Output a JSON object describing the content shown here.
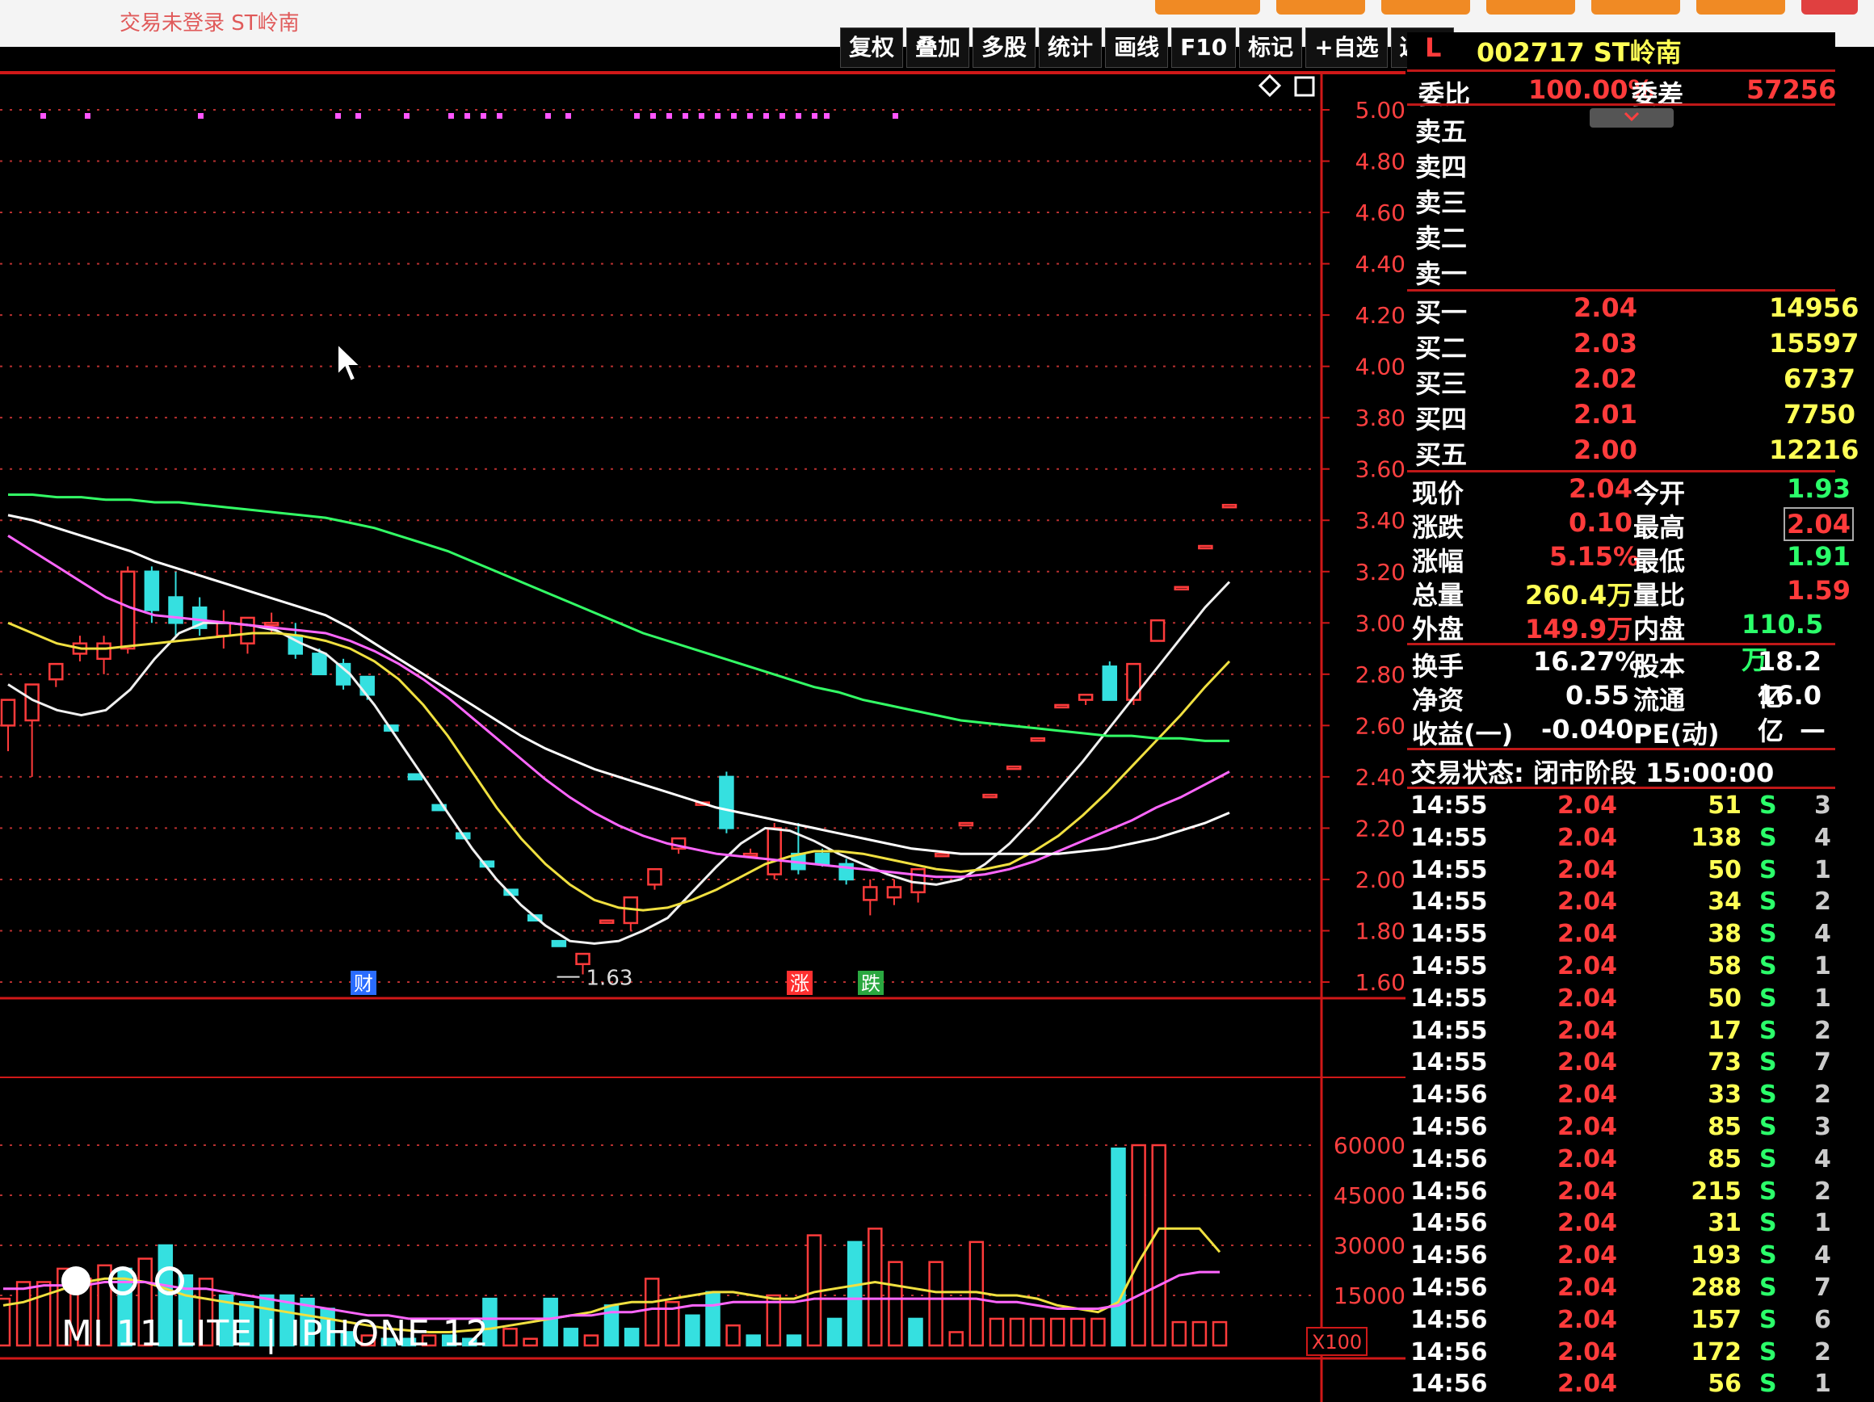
{
  "window": {
    "login_status": "交易未登录",
    "title_stock": "ST岭南"
  },
  "toolbar": {
    "buttons": [
      "复权",
      "叠加",
      "多股",
      "统计",
      "画线",
      "F10",
      "标记",
      "+自选",
      "返回"
    ]
  },
  "stock": {
    "level": "L",
    "code_name": "002717 ST岭南",
    "weibi_label": "委比",
    "weibi_value": "100.00%",
    "weicha_label": "委差",
    "weicha_value": "57256"
  },
  "order_book": {
    "sell": [
      {
        "label": "卖五",
        "price": "",
        "volume": ""
      },
      {
        "label": "卖四",
        "price": "",
        "volume": ""
      },
      {
        "label": "卖三",
        "price": "",
        "volume": ""
      },
      {
        "label": "卖二",
        "price": "",
        "volume": ""
      },
      {
        "label": "卖一",
        "price": "",
        "volume": ""
      }
    ],
    "buy": [
      {
        "label": "买一",
        "price": "2.04",
        "volume": "14956"
      },
      {
        "label": "买二",
        "price": "2.03",
        "volume": "15597"
      },
      {
        "label": "买三",
        "price": "2.02",
        "volume": "6737"
      },
      {
        "label": "买四",
        "price": "2.01",
        "volume": "7750"
      },
      {
        "label": "买五",
        "price": "2.00",
        "volume": "12216"
      }
    ]
  },
  "quote": [
    {
      "l1": "现价",
      "v1": "2.04",
      "l2": "今开",
      "v2": "1.93"
    },
    {
      "l1": "涨跌",
      "v1": "0.10",
      "l2": "最高",
      "v2": "2.04"
    },
    {
      "l1": "涨幅",
      "v1": "5.15%",
      "l2": "最低",
      "v2": "1.91"
    },
    {
      "l1": "总量",
      "v1": "260.4万",
      "l2": "量比",
      "v2": "1.59"
    },
    {
      "l1": "外盘",
      "v1": "149.9万",
      "l2": "内盘",
      "v2": "110.5万"
    }
  ],
  "fundamentals": [
    {
      "l1": "换手",
      "v1": "16.27%",
      "l2": "股本",
      "v2": "18.2亿"
    },
    {
      "l1": "净资",
      "v1": "0.55",
      "l2": "流通",
      "v2": "16.0亿"
    },
    {
      "l1": "收益(一)",
      "v1": "-0.040",
      "l2": "PE(动)",
      "v2": "—"
    }
  ],
  "trade_status": "交易状态: 闭市阶段 15:00:00",
  "ticks": [
    {
      "time": "14:55",
      "price": "2.04",
      "vol": "51",
      "side": "S",
      "n": "3"
    },
    {
      "time": "14:55",
      "price": "2.04",
      "vol": "138",
      "side": "S",
      "n": "4"
    },
    {
      "time": "14:55",
      "price": "2.04",
      "vol": "50",
      "side": "S",
      "n": "1"
    },
    {
      "time": "14:55",
      "price": "2.04",
      "vol": "34",
      "side": "S",
      "n": "2"
    },
    {
      "time": "14:55",
      "price": "2.04",
      "vol": "38",
      "side": "S",
      "n": "4"
    },
    {
      "time": "14:55",
      "price": "2.04",
      "vol": "58",
      "side": "S",
      "n": "1"
    },
    {
      "time": "14:55",
      "price": "2.04",
      "vol": "50",
      "side": "S",
      "n": "1"
    },
    {
      "time": "14:55",
      "price": "2.04",
      "vol": "17",
      "side": "S",
      "n": "2"
    },
    {
      "time": "14:55",
      "price": "2.04",
      "vol": "73",
      "side": "S",
      "n": "7"
    },
    {
      "time": "14:56",
      "price": "2.04",
      "vol": "33",
      "side": "S",
      "n": "2"
    },
    {
      "time": "14:56",
      "price": "2.04",
      "vol": "85",
      "side": "S",
      "n": "3"
    },
    {
      "time": "14:56",
      "price": "2.04",
      "vol": "85",
      "side": "S",
      "n": "4"
    },
    {
      "time": "14:56",
      "price": "2.04",
      "vol": "215",
      "side": "S",
      "n": "2"
    },
    {
      "time": "14:56",
      "price": "2.04",
      "vol": "31",
      "side": "S",
      "n": "1"
    },
    {
      "time": "14:56",
      "price": "2.04",
      "vol": "193",
      "side": "S",
      "n": "4"
    },
    {
      "time": "14:56",
      "price": "2.04",
      "vol": "288",
      "side": "S",
      "n": "7"
    },
    {
      "time": "14:56",
      "price": "2.04",
      "vol": "157",
      "side": "S",
      "n": "6"
    },
    {
      "time": "14:56",
      "price": "2.04",
      "vol": "172",
      "side": "S",
      "n": "2"
    },
    {
      "time": "14:56",
      "price": "2.04",
      "vol": "56",
      "side": "S",
      "n": "1"
    }
  ],
  "chart": {
    "price_ticks": [
      "5.00",
      "4.80",
      "4.60",
      "4.40",
      "4.20",
      "4.00",
      "3.80",
      "3.60",
      "3.40",
      "3.20",
      "3.00",
      "2.80",
      "2.60",
      "2.40",
      "2.20",
      "2.00",
      "1.80",
      "1.60"
    ],
    "volume_ticks": [
      "60000",
      "45000",
      "30000",
      "15000"
    ],
    "volume_unit": "X100",
    "low_marker": "1.63",
    "event_labels": [
      "财",
      "涨",
      "跌"
    ]
  },
  "chart_data": {
    "type": "candlestick",
    "ylim": [
      1.6,
      5.0
    ],
    "candles": [
      {
        "o": 2.6,
        "h": 2.7,
        "l": 2.5,
        "c": 2.7
      },
      {
        "o": 2.62,
        "h": 2.75,
        "l": 2.4,
        "c": 2.76
      },
      {
        "o": 2.78,
        "h": 2.82,
        "l": 2.75,
        "c": 2.84
      },
      {
        "o": 2.88,
        "h": 2.95,
        "l": 2.85,
        "c": 2.92
      },
      {
        "o": 2.86,
        "h": 2.95,
        "l": 2.8,
        "c": 2.92
      },
      {
        "o": 2.9,
        "h": 3.22,
        "l": 2.88,
        "c": 3.2
      },
      {
        "o": 3.2,
        "h": 3.22,
        "l": 3.0,
        "c": 3.05
      },
      {
        "o": 3.1,
        "h": 3.2,
        "l": 2.95,
        "c": 3.0
      },
      {
        "o": 3.06,
        "h": 3.1,
        "l": 2.95,
        "c": 2.98
      },
      {
        "o": 2.95,
        "h": 3.05,
        "l": 2.9,
        "c": 3.0
      },
      {
        "o": 2.92,
        "h": 3.02,
        "l": 2.88,
        "c": 3.02
      },
      {
        "o": 3.0,
        "h": 3.04,
        "l": 2.96,
        "c": 3.0
      },
      {
        "o": 2.95,
        "h": 3.0,
        "l": 2.86,
        "c": 2.88
      },
      {
        "o": 2.88,
        "h": 2.9,
        "l": 2.8,
        "c": 2.8
      },
      {
        "o": 2.84,
        "h": 2.86,
        "l": 2.74,
        "c": 2.76
      },
      {
        "o": 2.79,
        "h": 2.79,
        "l": 2.7,
        "c": 2.72
      },
      {
        "o": 2.6,
        "h": 2.6,
        "l": 2.58,
        "c": 2.58
      },
      {
        "o": 2.41,
        "h": 2.41,
        "l": 2.39,
        "c": 2.39
      },
      {
        "o": 2.29,
        "h": 2.29,
        "l": 2.27,
        "c": 2.27
      },
      {
        "o": 2.18,
        "h": 2.18,
        "l": 2.16,
        "c": 2.16
      },
      {
        "o": 2.07,
        "h": 2.07,
        "l": 2.05,
        "c": 2.05
      },
      {
        "o": 1.96,
        "h": 1.96,
        "l": 1.94,
        "c": 1.94
      },
      {
        "o": 1.86,
        "h": 1.86,
        "l": 1.84,
        "c": 1.84
      },
      {
        "o": 1.76,
        "h": 1.76,
        "l": 1.74,
        "c": 1.74
      },
      {
        "o": 1.67,
        "h": 1.7,
        "l": 1.63,
        "c": 1.71
      },
      {
        "o": 1.84,
        "h": 1.84,
        "l": 1.84,
        "c": 1.84
      },
      {
        "o": 1.83,
        "h": 1.93,
        "l": 1.8,
        "c": 1.93
      },
      {
        "o": 1.98,
        "h": 2.04,
        "l": 1.96,
        "c": 2.04
      },
      {
        "o": 2.12,
        "h": 2.16,
        "l": 2.1,
        "c": 2.16
      },
      {
        "o": 2.3,
        "h": 2.3,
        "l": 2.3,
        "c": 2.3
      },
      {
        "o": 2.4,
        "h": 2.42,
        "l": 2.18,
        "c": 2.2
      },
      {
        "o": 2.1,
        "h": 2.12,
        "l": 2.09,
        "c": 2.1
      },
      {
        "o": 2.02,
        "h": 2.22,
        "l": 2.0,
        "c": 2.2
      },
      {
        "o": 2.1,
        "h": 2.22,
        "l": 2.02,
        "c": 2.04
      },
      {
        "o": 2.1,
        "h": 2.12,
        "l": 2.05,
        "c": 2.06
      },
      {
        "o": 2.06,
        "h": 2.08,
        "l": 1.98,
        "c": 2.0
      },
      {
        "o": 1.92,
        "h": 2.0,
        "l": 1.86,
        "c": 1.97
      },
      {
        "o": 1.93,
        "h": 2.0,
        "l": 1.9,
        "c": 1.97
      },
      {
        "o": 1.95,
        "h": 2.04,
        "l": 1.91,
        "c": 2.04
      },
      {
        "o": 2.1,
        "h": 2.1,
        "l": 2.1,
        "c": 2.1
      },
      {
        "o": 2.22,
        "h": 2.22,
        "l": 2.22,
        "c": 2.22
      },
      {
        "o": 2.33,
        "h": 2.33,
        "l": 2.33,
        "c": 2.33
      },
      {
        "o": 2.44,
        "h": 2.44,
        "l": 2.44,
        "c": 2.44
      },
      {
        "o": 2.55,
        "h": 2.55,
        "l": 2.55,
        "c": 2.55
      },
      {
        "o": 2.68,
        "h": 2.68,
        "l": 2.68,
        "c": 2.68
      },
      {
        "o": 2.7,
        "h": 2.72,
        "l": 2.68,
        "c": 2.72
      },
      {
        "o": 2.83,
        "h": 2.85,
        "l": 2.7,
        "c": 2.7
      },
      {
        "o": 2.7,
        "h": 2.84,
        "l": 2.68,
        "c": 2.84
      },
      {
        "o": 2.93,
        "h": 3.01,
        "l": 2.93,
        "c": 3.01
      },
      {
        "o": 3.14,
        "h": 3.14,
        "l": 3.14,
        "c": 3.14
      },
      {
        "o": 3.3,
        "h": 3.3,
        "l": 3.3,
        "c": 3.3
      },
      {
        "o": 3.46,
        "h": 3.46,
        "l": 3.46,
        "c": 3.46
      }
    ],
    "ma_series": [
      {
        "color": "#f0f0f0",
        "values": [
          2.76,
          2.7,
          2.66,
          2.64,
          2.66,
          2.74,
          2.86,
          2.96,
          3.0,
          3.0,
          2.99,
          2.97,
          2.92,
          2.88,
          2.8,
          2.68,
          2.54,
          2.4,
          2.26,
          2.12,
          2.0,
          1.9,
          1.82,
          1.76,
          1.75,
          1.76,
          1.8,
          1.85,
          1.95,
          2.05,
          2.14,
          2.2,
          2.19,
          2.15,
          2.1,
          2.06,
          2.02,
          1.99,
          1.98,
          2.0,
          2.06,
          2.14,
          2.24,
          2.35,
          2.46,
          2.58,
          2.7,
          2.82,
          2.94,
          3.06,
          3.16
        ]
      },
      {
        "color": "#f0e040",
        "values": [
          3.0,
          2.96,
          2.92,
          2.9,
          2.9,
          2.91,
          2.92,
          2.93,
          2.94,
          2.95,
          2.96,
          2.96,
          2.95,
          2.93,
          2.9,
          2.85,
          2.78,
          2.68,
          2.56,
          2.42,
          2.28,
          2.16,
          2.06,
          1.98,
          1.92,
          1.89,
          1.88,
          1.89,
          1.92,
          1.96,
          2.01,
          2.06,
          2.09,
          2.11,
          2.11,
          2.1,
          2.08,
          2.06,
          2.04,
          2.03,
          2.04,
          2.06,
          2.11,
          2.17,
          2.25,
          2.34,
          2.44,
          2.54,
          2.64,
          2.75,
          2.85
        ]
      },
      {
        "color": "#ff66ff",
        "values": [
          3.34,
          3.28,
          3.22,
          3.16,
          3.1,
          3.06,
          3.03,
          3.02,
          3.01,
          3.0,
          2.99,
          2.98,
          2.97,
          2.96,
          2.93,
          2.89,
          2.84,
          2.78,
          2.71,
          2.63,
          2.55,
          2.47,
          2.39,
          2.32,
          2.26,
          2.21,
          2.17,
          2.14,
          2.12,
          2.1,
          2.09,
          2.08,
          2.07,
          2.06,
          2.05,
          2.04,
          2.03,
          2.02,
          2.01,
          2.01,
          2.02,
          2.04,
          2.07,
          2.11,
          2.15,
          2.19,
          2.23,
          2.28,
          2.32,
          2.37,
          2.42
        ]
      },
      {
        "color": "#ffffff",
        "values": [
          3.42,
          3.4,
          3.37,
          3.34,
          3.31,
          3.28,
          3.24,
          3.21,
          3.18,
          3.15,
          3.12,
          3.09,
          3.06,
          3.03,
          2.98,
          2.92,
          2.86,
          2.8,
          2.74,
          2.68,
          2.62,
          2.56,
          2.51,
          2.47,
          2.43,
          2.4,
          2.37,
          2.34,
          2.31,
          2.28,
          2.26,
          2.24,
          2.22,
          2.2,
          2.18,
          2.16,
          2.14,
          2.12,
          2.11,
          2.1,
          2.1,
          2.1,
          2.1,
          2.1,
          2.11,
          2.12,
          2.14,
          2.16,
          2.19,
          2.22,
          2.26
        ]
      },
      {
        "color": "#33ff66",
        "values": [
          3.5,
          3.5,
          3.49,
          3.49,
          3.48,
          3.48,
          3.47,
          3.47,
          3.46,
          3.45,
          3.44,
          3.43,
          3.42,
          3.41,
          3.39,
          3.37,
          3.34,
          3.31,
          3.28,
          3.24,
          3.2,
          3.16,
          3.12,
          3.08,
          3.04,
          3.0,
          2.96,
          2.93,
          2.9,
          2.87,
          2.84,
          2.81,
          2.78,
          2.75,
          2.73,
          2.7,
          2.68,
          2.66,
          2.64,
          2.62,
          2.61,
          2.6,
          2.59,
          2.58,
          2.57,
          2.56,
          2.56,
          2.55,
          2.55,
          2.54,
          2.54
        ]
      }
    ],
    "volume_ylim": [
      0,
      75000
    ],
    "volumes": [
      14000,
      19000,
      19000,
      23000,
      20000,
      24000,
      23000,
      26000,
      30000,
      21000,
      20000,
      15000,
      13000,
      15000,
      15000,
      14000,
      11000,
      4000,
      3000,
      2000,
      2000,
      3000,
      3000,
      2000,
      14000,
      5000,
      2000,
      14000,
      5000,
      3000,
      12000,
      5000,
      20000,
      13000,
      9000,
      16000,
      6000,
      3000,
      15000,
      3000,
      33000,
      8000,
      31000,
      35000,
      25000,
      8000,
      25000,
      4000,
      31000,
      8000,
      8000,
      8000,
      8000,
      8000,
      8000,
      59000,
      60000,
      60000,
      7000,
      7000,
      7000
    ],
    "volume_up": [
      true,
      true,
      true,
      true,
      true,
      true,
      false,
      true,
      false,
      false,
      true,
      false,
      false,
      false,
      false,
      false,
      false,
      false,
      true,
      false,
      false,
      true,
      false,
      false,
      false,
      true,
      true,
      false,
      false,
      true,
      false,
      false,
      true,
      true,
      false,
      false,
      true,
      false,
      true,
      false,
      true,
      false,
      false,
      true,
      true,
      false,
      true,
      true,
      true,
      true,
      true,
      true,
      true,
      true,
      true,
      false,
      true,
      true,
      true,
      true,
      true
    ],
    "volume_ma": [
      {
        "color": "#f0e040",
        "values": [
          12000,
          13000,
          15000,
          17000,
          19000,
          20000,
          20000,
          19000,
          17000,
          15000,
          14000,
          13000,
          12000,
          11000,
          10000,
          9000,
          8000,
          7000,
          6000,
          5000,
          4500,
          4000,
          4000,
          4500,
          5000,
          6000,
          7000,
          8000,
          9000,
          10000,
          12000,
          13000,
          13000,
          14000,
          15000,
          16000,
          16000,
          15000,
          14000,
          14000,
          16000,
          17000,
          18000,
          19000,
          18000,
          17000,
          16000,
          16000,
          16000,
          15000,
          15000,
          14000,
          12000,
          11000,
          10000,
          13000,
          25000,
          35000,
          35000,
          35000,
          28000
        ]
      },
      {
        "color": "#ff66ff",
        "values": [
          17000,
          17000,
          18000,
          18000,
          18000,
          19000,
          19000,
          19000,
          18000,
          17000,
          17000,
          16000,
          15000,
          14000,
          13000,
          12000,
          11000,
          10000,
          9000,
          9000,
          8000,
          8000,
          8000,
          8000,
          8000,
          8000,
          8000,
          8000,
          9000,
          9000,
          10000,
          10000,
          11000,
          11000,
          12000,
          12000,
          13000,
          13000,
          13000,
          13000,
          14000,
          14000,
          14000,
          14000,
          14000,
          14000,
          14000,
          14000,
          14000,
          13000,
          13000,
          12000,
          11000,
          11000,
          11000,
          12000,
          15000,
          18000,
          21000,
          22000,
          22000
        ]
      }
    ]
  },
  "watermark": "MI 11 LITE | IPHONE 12"
}
